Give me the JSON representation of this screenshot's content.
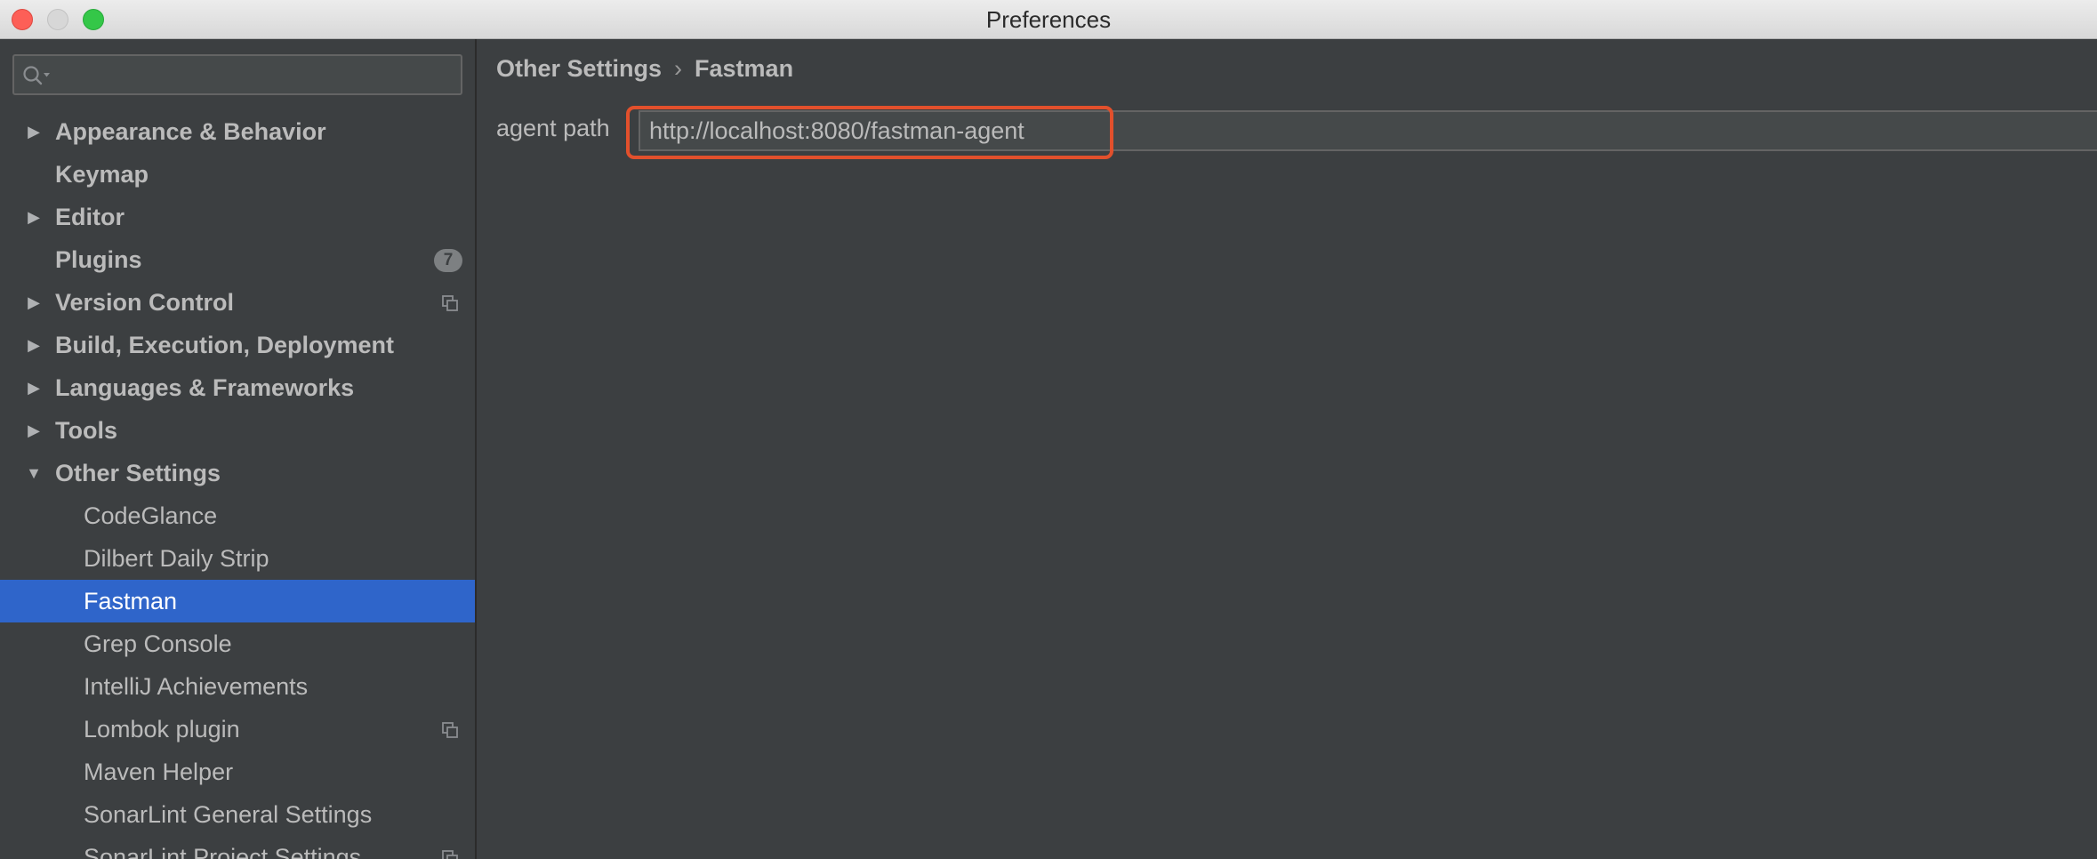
{
  "window": {
    "title": "Preferences"
  },
  "sidebar": {
    "search": {
      "value": "",
      "placeholder": ""
    },
    "items": [
      {
        "label": "Appearance & Behavior",
        "expander": "▶"
      },
      {
        "label": "Keymap"
      },
      {
        "label": "Editor",
        "expander": "▶"
      },
      {
        "label": "Plugins",
        "badge": "7"
      },
      {
        "label": "Version Control",
        "expander": "▶"
      },
      {
        "label": "Build, Execution, Deployment",
        "expander": "▶"
      },
      {
        "label": "Languages & Frameworks",
        "expander": "▶"
      },
      {
        "label": "Tools",
        "expander": "▶"
      },
      {
        "label": "Other Settings",
        "expander": "▼"
      },
      {
        "label": "CodeGlance"
      },
      {
        "label": "Dilbert Daily Strip"
      },
      {
        "label": "Fastman"
      },
      {
        "label": "Grep Console"
      },
      {
        "label": "IntelliJ Achievements"
      },
      {
        "label": "Lombok plugin"
      },
      {
        "label": "Maven Helper"
      },
      {
        "label": "SonarLint General Settings"
      },
      {
        "label": "SonarLint Project Settings"
      }
    ]
  },
  "main": {
    "breadcrumb": {
      "parent": "Other Settings",
      "separator": "›",
      "current": "Fastman"
    },
    "agent_path": {
      "label": "agent path",
      "value": "http://localhost:8080/fastman-agent"
    }
  },
  "colors": {
    "selection": "#2f65ca",
    "highlight_box": "#e2502c",
    "background": "#3c3f41"
  }
}
